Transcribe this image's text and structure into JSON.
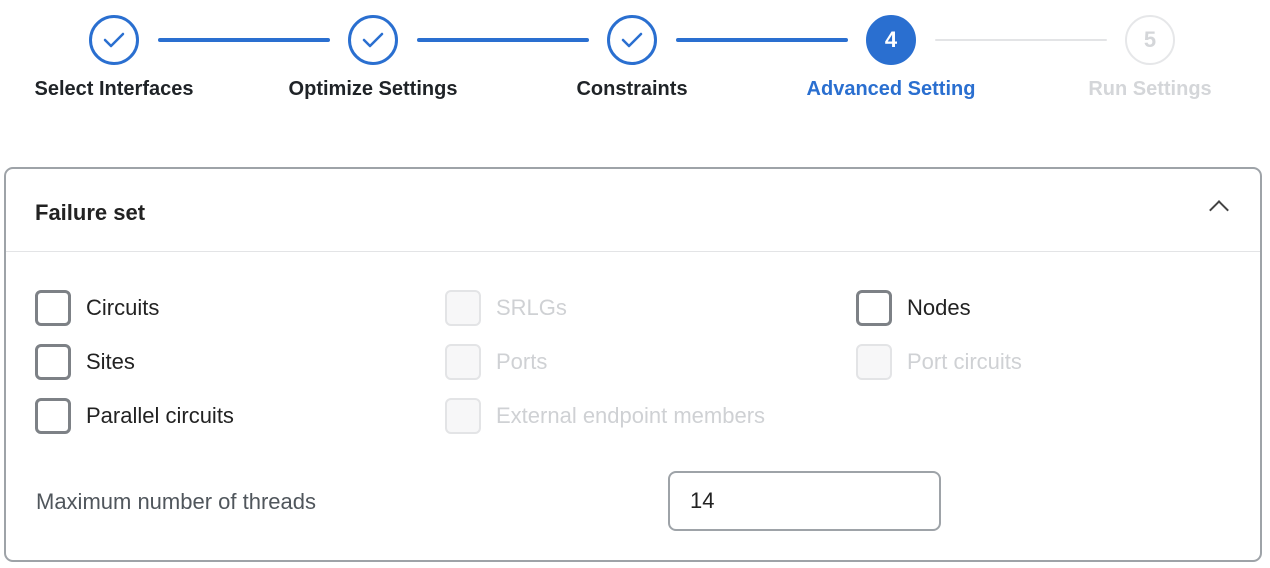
{
  "stepper": {
    "steps": [
      {
        "label": "Select Interfaces",
        "state": "done",
        "number": "1"
      },
      {
        "label": "Optimize Settings",
        "state": "done",
        "number": "2"
      },
      {
        "label": "Constraints",
        "state": "done",
        "number": "3"
      },
      {
        "label": "Advanced Setting",
        "state": "active",
        "number": "4"
      },
      {
        "label": "Run Settings",
        "state": "todo",
        "number": "5"
      }
    ]
  },
  "panel": {
    "title": "Failure set",
    "checkboxes": [
      {
        "label": "Circuits",
        "checked": false,
        "disabled": false
      },
      {
        "label": "SRLGs",
        "checked": false,
        "disabled": true
      },
      {
        "label": "Nodes",
        "checked": false,
        "disabled": false
      },
      {
        "label": "Sites",
        "checked": false,
        "disabled": false
      },
      {
        "label": "Ports",
        "checked": false,
        "disabled": true
      },
      {
        "label": "Port circuits",
        "checked": false,
        "disabled": true
      },
      {
        "label": "Parallel circuits",
        "checked": false,
        "disabled": false
      },
      {
        "label": "External endpoint members",
        "checked": false,
        "disabled": true
      }
    ],
    "threads_label": "Maximum number of threads",
    "threads_value": "14"
  },
  "colors": {
    "accent": "#2a6fd0"
  }
}
